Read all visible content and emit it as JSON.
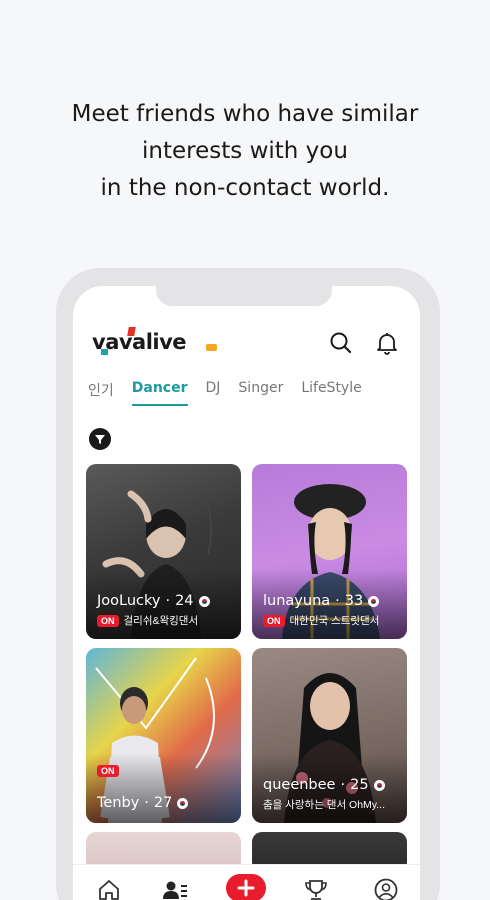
{
  "headline": {
    "line1": "Meet friends who have similar",
    "line2": "interests with you",
    "line3": "in the non-contact world."
  },
  "app": {
    "logo_text": "vavalive"
  },
  "tabs": [
    {
      "label": "인기",
      "active": false
    },
    {
      "label": "Dancer",
      "active": true
    },
    {
      "label": "DJ",
      "active": false
    },
    {
      "label": "Singer",
      "active": false
    },
    {
      "label": "LifeStyle",
      "active": false
    }
  ],
  "cards": [
    {
      "name": "JooLucky",
      "age": "24",
      "live": "ON",
      "subtitle": "걸리쉬&왁킹댄서"
    },
    {
      "name": "lunayuna",
      "age": "33",
      "live": "ON",
      "subtitle": "대한민국 스트릿댄서"
    },
    {
      "name": "Tenby",
      "age": "27",
      "live": "ON",
      "subtitle": ""
    },
    {
      "name": "queenbee",
      "age": "25",
      "live": "",
      "subtitle": "춤을 사랑하는 댄서 OhMy..."
    }
  ],
  "colors": {
    "accent": "#1d9aa0",
    "live_badge": "#e81c2d",
    "background": "#f6f7f9"
  },
  "icons": {
    "search": "search-icon",
    "bell": "bell-icon",
    "filter": "filter-icon",
    "home": "home-icon",
    "people": "people-list-icon",
    "plus": "plus-icon",
    "trophy": "trophy-icon",
    "profile": "profile-icon"
  }
}
